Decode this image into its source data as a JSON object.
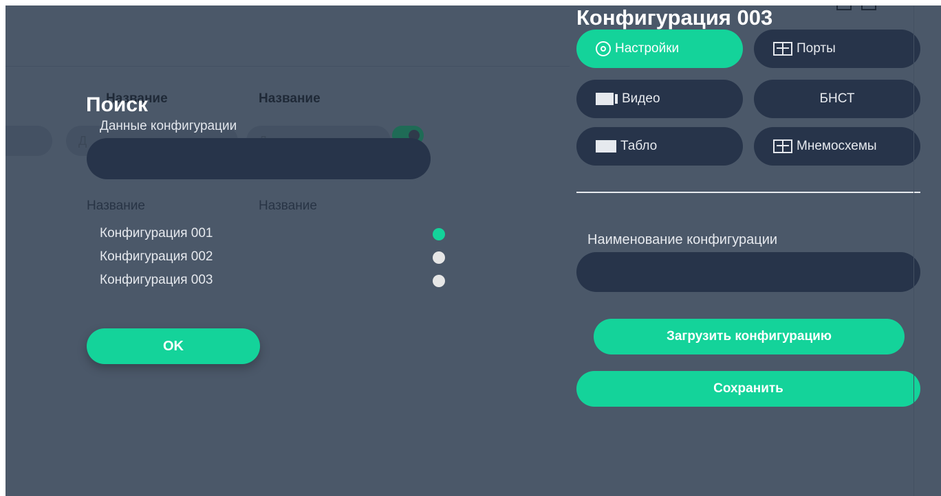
{
  "background": {
    "header_left": "Название",
    "header_right": "Название",
    "input_left_placeholder": "Д",
    "input_right_placeholder": "Д"
  },
  "modal": {
    "title": "Поиск",
    "field_label": "Данные конфигурации",
    "field_value": "",
    "columns": [
      "Название",
      "Название"
    ],
    "rows": [
      {
        "name": "Конфигурация 001",
        "status_color": "#14d39a"
      },
      {
        "name": "Конфигурация 002",
        "status_color": "#e6e6e6"
      },
      {
        "name": "Конфигурация 003",
        "status_color": "#e6e6e6"
      }
    ],
    "ok_label": "OK"
  },
  "panel": {
    "title": "Конфигурация 003",
    "tabs": [
      {
        "label": "Настройки",
        "icon": "gear-icon",
        "active": true
      },
      {
        "label": "Порты",
        "icon": "panel-icon",
        "active": false
      },
      {
        "label": "Видео",
        "icon": "video-icon",
        "active": false
      },
      {
        "label": "БНСТ",
        "icon": "",
        "active": false
      },
      {
        "label": "Табло",
        "icon": "board-icon",
        "active": false
      },
      {
        "label": "Мнемосхемы",
        "icon": "panel-icon",
        "active": false
      }
    ],
    "name_label": "Наименование конфигурации",
    "name_value": "",
    "load_label": "Загрузить конфигурацию",
    "save_label": "Сохранить"
  },
  "colors": {
    "accent": "#14d39a",
    "background": "#4b5869",
    "input_bg": "#27344a"
  }
}
